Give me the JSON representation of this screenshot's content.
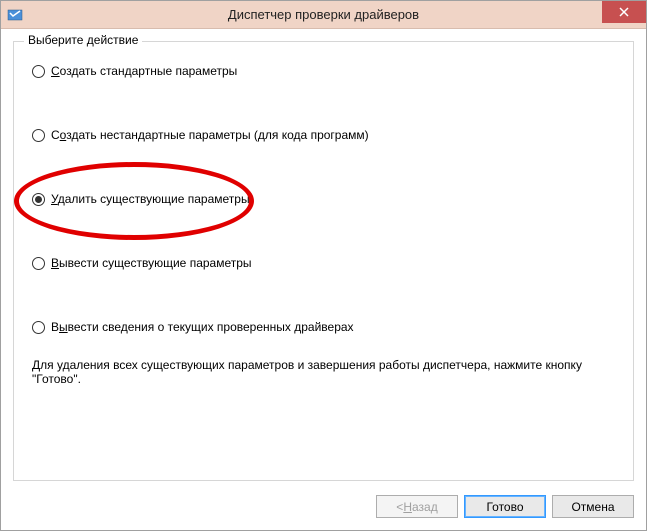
{
  "window": {
    "title": "Диспетчер проверки драйверов"
  },
  "fieldset": {
    "legend": "Выберите действие"
  },
  "options": {
    "opt1": {
      "prefix": "",
      "u": "С",
      "rest": "оздать стандартные параметры",
      "selected": false
    },
    "opt2": {
      "prefix": "С",
      "u": "о",
      "rest": "здать нестандартные параметры (для кода программ)",
      "selected": false
    },
    "opt3": {
      "prefix": "",
      "u": "У",
      "rest": "далить существующие параметры",
      "selected": true
    },
    "opt4": {
      "prefix": "",
      "u": "В",
      "rest": "ывести существующие параметры",
      "selected": false
    },
    "opt5": {
      "prefix": "В",
      "u": "ы",
      "rest": "вести сведения о текущих проверенных драйверах",
      "selected": false
    }
  },
  "hint": "Для удаления всех существующих параметров и завершения работы диспетчера, нажмите кнопку \"Готово\".",
  "buttons": {
    "back": {
      "prefix": "< ",
      "u": "Н",
      "rest": "азад",
      "enabled": false
    },
    "finish": {
      "label": "Готово",
      "enabled": true,
      "default": true
    },
    "cancel": {
      "label": "Отмена",
      "enabled": true
    }
  },
  "annotation": {
    "highlight_option": "opt3"
  }
}
